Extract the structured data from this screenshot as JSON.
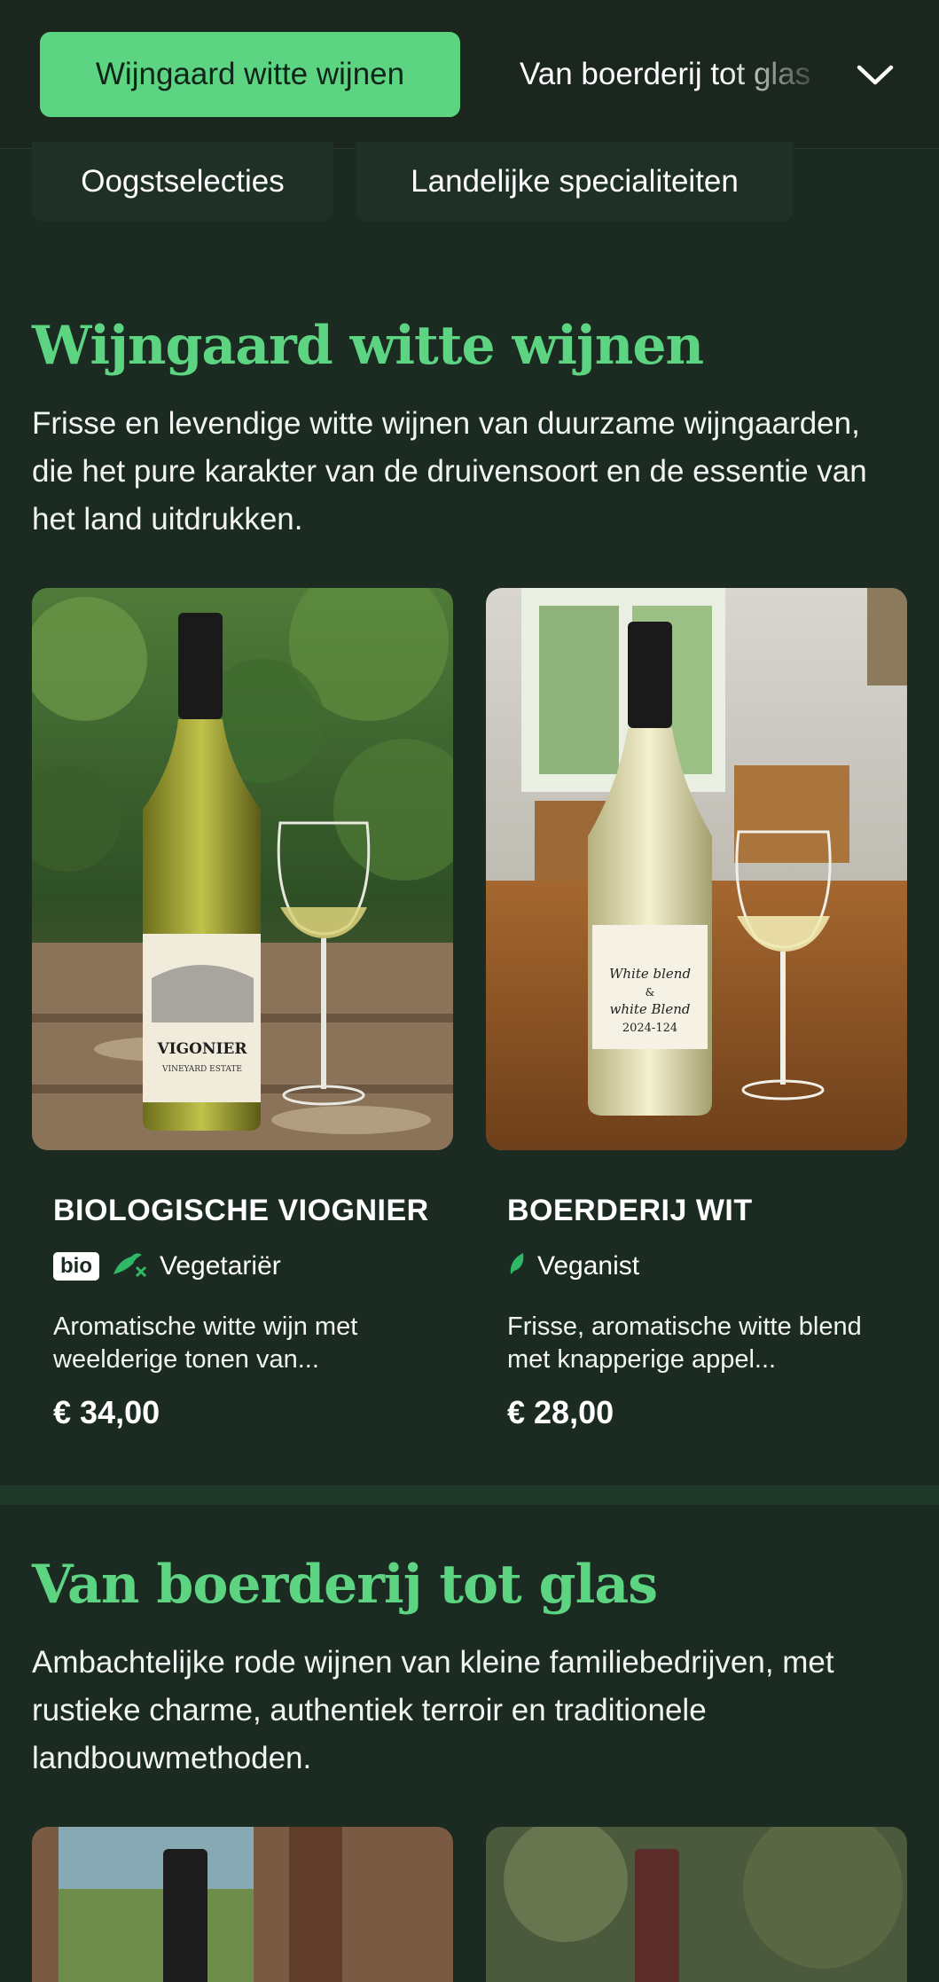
{
  "nav": {
    "active_tab": "Wijngaard witte wijnen",
    "next_tab": "Van boerderij tot glas",
    "chips": [
      "Oogstselecties",
      "Landelijke specialiteiten"
    ]
  },
  "section1": {
    "title": "Wijngaard witte wijnen",
    "description": "Frisse en levendige witte wijnen van duurzame wijngaarden, die het pure karakter van de druivensoort en de essentie van het land uitdrukken.",
    "products": [
      {
        "name": "BIOLOGISCHE VIOGNIER",
        "badge": "bio",
        "diet": "Vegetariër",
        "description": "Aromatische witte wijn met weelderige tonen van...",
        "price": "€ 34,00",
        "label_text": "VIGONIER",
        "label_sub": "VINEYARD ESTATE"
      },
      {
        "name": "BOERDERIJ WIT",
        "diet": "Veganist",
        "description": "Frisse, aromatische witte blend met knapperige appel...",
        "price": "€ 28,00",
        "label_text": "White blend & white Blend 2024-124"
      }
    ]
  },
  "section2": {
    "title": "Van boerderij tot glas",
    "description": "Ambachtelijke rode wijnen van kleine familiebedrijven, met rustieke charme, authentiek terroir en traditionele landbouwmethoden."
  },
  "colors": {
    "background": "#1b2b22",
    "accent": "#5dd482",
    "diet_icon": "#2fb866"
  }
}
